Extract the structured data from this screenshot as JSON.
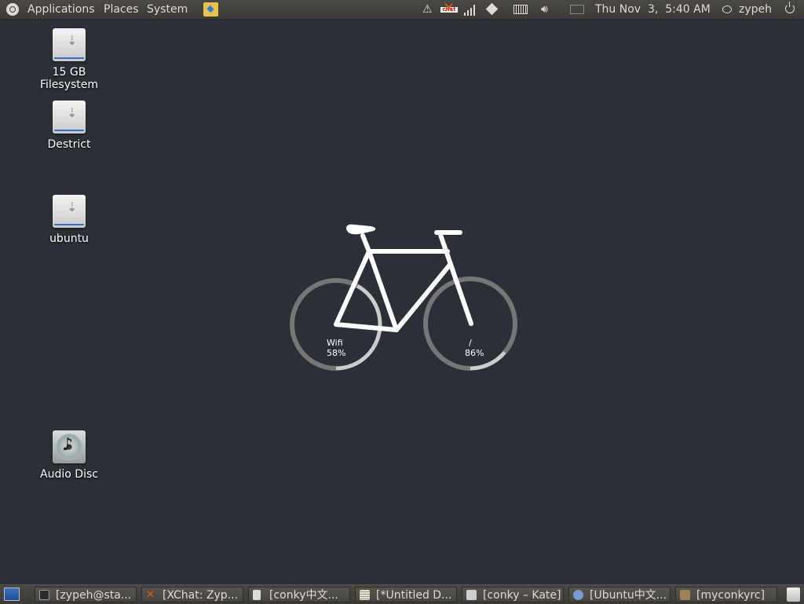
{
  "top_panel": {
    "menus": [
      "Applications",
      "Places",
      "System"
    ],
    "clock": "Thu Nov  3,  5:40 AM",
    "user": "zypeh",
    "tray_icons": [
      "warning-icon",
      "xchat-icon",
      "signal-icon",
      "dropbox-icon",
      "keyboard-icon",
      "volume-icon",
      "mail-icon"
    ]
  },
  "desktop": {
    "icons": [
      {
        "label": "15 GB Filesystem",
        "icon": "usb-drive-icon"
      },
      {
        "label": "Destrict",
        "icon": "usb-drive-icon"
      },
      {
        "label": "ubuntu",
        "icon": "usb-drive-icon"
      },
      {
        "label": "Audio Disc",
        "icon": "audio-cd-icon"
      }
    ]
  },
  "conky": {
    "wifi_label": "Wifi",
    "wifi_value": "58%",
    "wifi_fraction": 0.58,
    "root_label": "/",
    "root_value": "86%",
    "root_fraction": 0.86
  },
  "taskbar": {
    "tasks": [
      {
        "label": "[zypeh@sta...",
        "icon": "terminal-icon"
      },
      {
        "label": "[XChat: Zyp...",
        "icon": "xchat-icon"
      },
      {
        "label": "[conky中文...",
        "icon": "document-icon"
      },
      {
        "label": "[*Untitled D...",
        "icon": "text-editor-icon"
      },
      {
        "label": "[conky – Kate]",
        "icon": "kate-icon"
      },
      {
        "label": "[Ubuntu中文...",
        "icon": "browser-icon"
      },
      {
        "label": "[myconkyrc]",
        "icon": "folder-icon"
      }
    ]
  },
  "colors": {
    "desktop_bg": "#2c2f37",
    "panel_bg": "#3c3b37",
    "ring_fill": "#767676",
    "ring_track": "#cccccc"
  }
}
